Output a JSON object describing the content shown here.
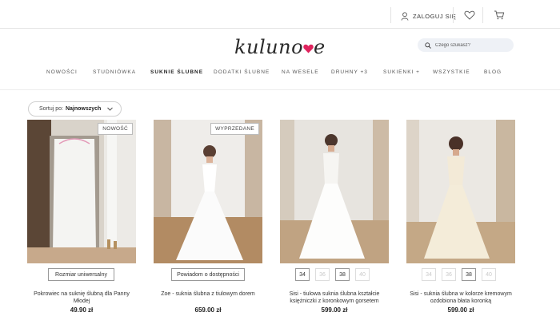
{
  "header": {
    "login_label": "ZALOGUJ SIĘ",
    "search_placeholder": "Czego szukasz?"
  },
  "logo": {
    "text_start": "kuluno",
    "text_end": "e",
    "accent_color": "#e0245e"
  },
  "nav": {
    "items": [
      "NOWOŚCI",
      "STUDNIÓWKA",
      "SUKNIE ŚLUBNE",
      "DODATKI ŚLUBNE",
      "NA WESELE",
      "DRUHNY +3",
      "SUKIENKI +",
      "WSZYSTKIE",
      "BLOG"
    ],
    "active": "SUKNIE ŚLUBNE"
  },
  "sort": {
    "label": "Sortuj po:",
    "value": "Najnowszych"
  },
  "products": [
    {
      "badge": "NOWOŚĆ",
      "button": "Rozmiar uniwersalny",
      "name": "Pokrowiec na suknię ślubną dla Panny Młodej",
      "price": "49.90 zł"
    },
    {
      "badge": "WYPRZEDANE",
      "button": "Powiadom o dostępności",
      "name": "Zoe - suknia ślubna z tiulowym dorem",
      "price": "659.00 zł"
    },
    {
      "sizes": [
        "34",
        "36",
        "38",
        "40"
      ],
      "sizes_available": [
        true,
        false,
        true,
        false
      ],
      "name": "Sisi - tiulowa suknia ślubna kształcie księżniczki z koronkowym gorsetem",
      "price": "599.00 zł"
    },
    {
      "sizes": [
        "34",
        "36",
        "38",
        "40"
      ],
      "sizes_available": [
        false,
        false,
        true,
        false
      ],
      "name": "Sisi - suknia ślubna w kolorze kremowym ozdobiona błata koronką",
      "price": "599.00 zł"
    }
  ]
}
